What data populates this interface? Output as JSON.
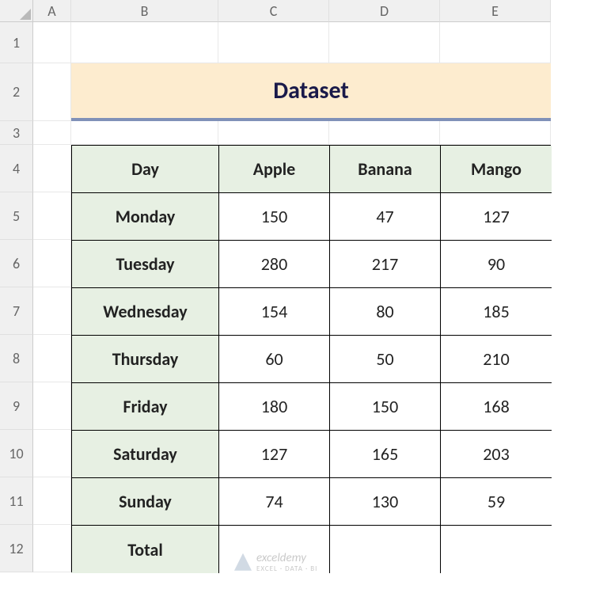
{
  "columns": [
    "A",
    "B",
    "C",
    "D",
    "E"
  ],
  "rows": [
    "1",
    "2",
    "3",
    "4",
    "5",
    "6",
    "7",
    "8",
    "9",
    "10",
    "11",
    "12"
  ],
  "title": "Dataset",
  "table": {
    "headers": [
      "Day",
      "Apple",
      "Banana",
      "Mango"
    ],
    "rows": [
      {
        "day": "Monday",
        "apple": "150",
        "banana": "47",
        "mango": "127"
      },
      {
        "day": "Tuesday",
        "apple": "280",
        "banana": "217",
        "mango": "90"
      },
      {
        "day": "Wednesday",
        "apple": "154",
        "banana": "80",
        "mango": "185"
      },
      {
        "day": "Thursday",
        "apple": "60",
        "banana": "50",
        "mango": "210"
      },
      {
        "day": "Friday",
        "apple": "180",
        "banana": "150",
        "mango": "168"
      },
      {
        "day": "Saturday",
        "apple": "127",
        "banana": "165",
        "mango": "203"
      },
      {
        "day": "Sunday",
        "apple": "74",
        "banana": "130",
        "mango": "59"
      }
    ],
    "total_label": "Total",
    "totals": {
      "apple": "",
      "banana": "",
      "mango": ""
    }
  },
  "watermark": {
    "main": "exceldemy",
    "sub": "EXCEL · DATA · BI"
  }
}
